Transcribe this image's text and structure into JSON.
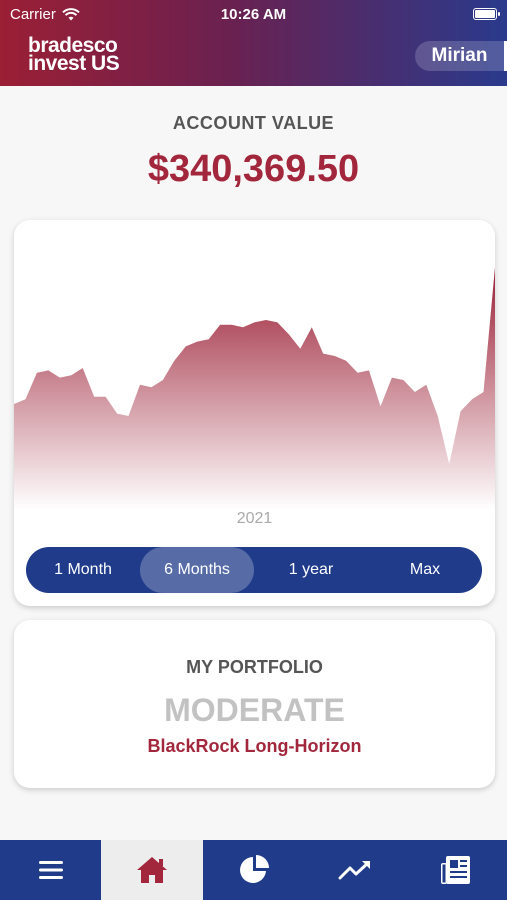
{
  "status_bar": {
    "carrier": "Carrier",
    "time": "10:26 AM"
  },
  "header": {
    "logo_line1": "bradesco",
    "logo_line2": "invest US",
    "user_name": "Mirian"
  },
  "account": {
    "label": "ACCOUNT VALUE",
    "value": "$340,369.50"
  },
  "chart_data": {
    "type": "area",
    "x_label": "2021",
    "values": [
      0.4,
      0.42,
      0.53,
      0.54,
      0.51,
      0.52,
      0.55,
      0.43,
      0.43,
      0.36,
      0.35,
      0.48,
      0.47,
      0.5,
      0.58,
      0.64,
      0.66,
      0.67,
      0.73,
      0.73,
      0.72,
      0.74,
      0.75,
      0.74,
      0.69,
      0.63,
      0.72,
      0.61,
      0.6,
      0.58,
      0.53,
      0.54,
      0.39,
      0.51,
      0.5,
      0.45,
      0.48,
      0.35,
      0.15,
      0.37,
      0.42,
      0.45,
      0.97
    ],
    "colors": {
      "top": "#9b1f35",
      "bottom": "#ffffff"
    }
  },
  "range_selector": {
    "options": [
      "1 Month",
      "6 Months",
      "1 year",
      "Max"
    ],
    "selected": "6 Months"
  },
  "portfolio": {
    "title": "MY PORTFOLIO",
    "profile": "MODERATE",
    "fund": "BlackRock Long-Horizon"
  },
  "tabbar": {
    "items": [
      "menu-icon",
      "home-icon",
      "pie-chart-icon",
      "trending-up-icon",
      "news-icon"
    ],
    "active": "home-icon"
  }
}
